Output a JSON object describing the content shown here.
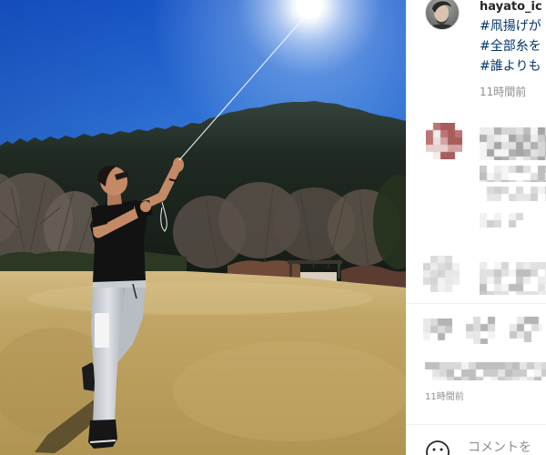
{
  "post": {
    "username": "hayato_ic",
    "caption_lines": [
      "#凧揚げが",
      "#全部糸を",
      "#誰よりも"
    ],
    "caption_time": "11時間前"
  },
  "actions": {
    "time": "11時間前"
  },
  "comment_box": {
    "placeholder": "コメントを"
  },
  "icons": {
    "profile": "profile-avatar",
    "actions": [
      "heart-icon",
      "comment-icon",
      "share-icon"
    ],
    "emoji": "smiley-icon"
  },
  "colors": {
    "text": "#262626",
    "hashtag": "#00376b",
    "muted": "#8e8e8e",
    "divider": "#efefef"
  }
}
